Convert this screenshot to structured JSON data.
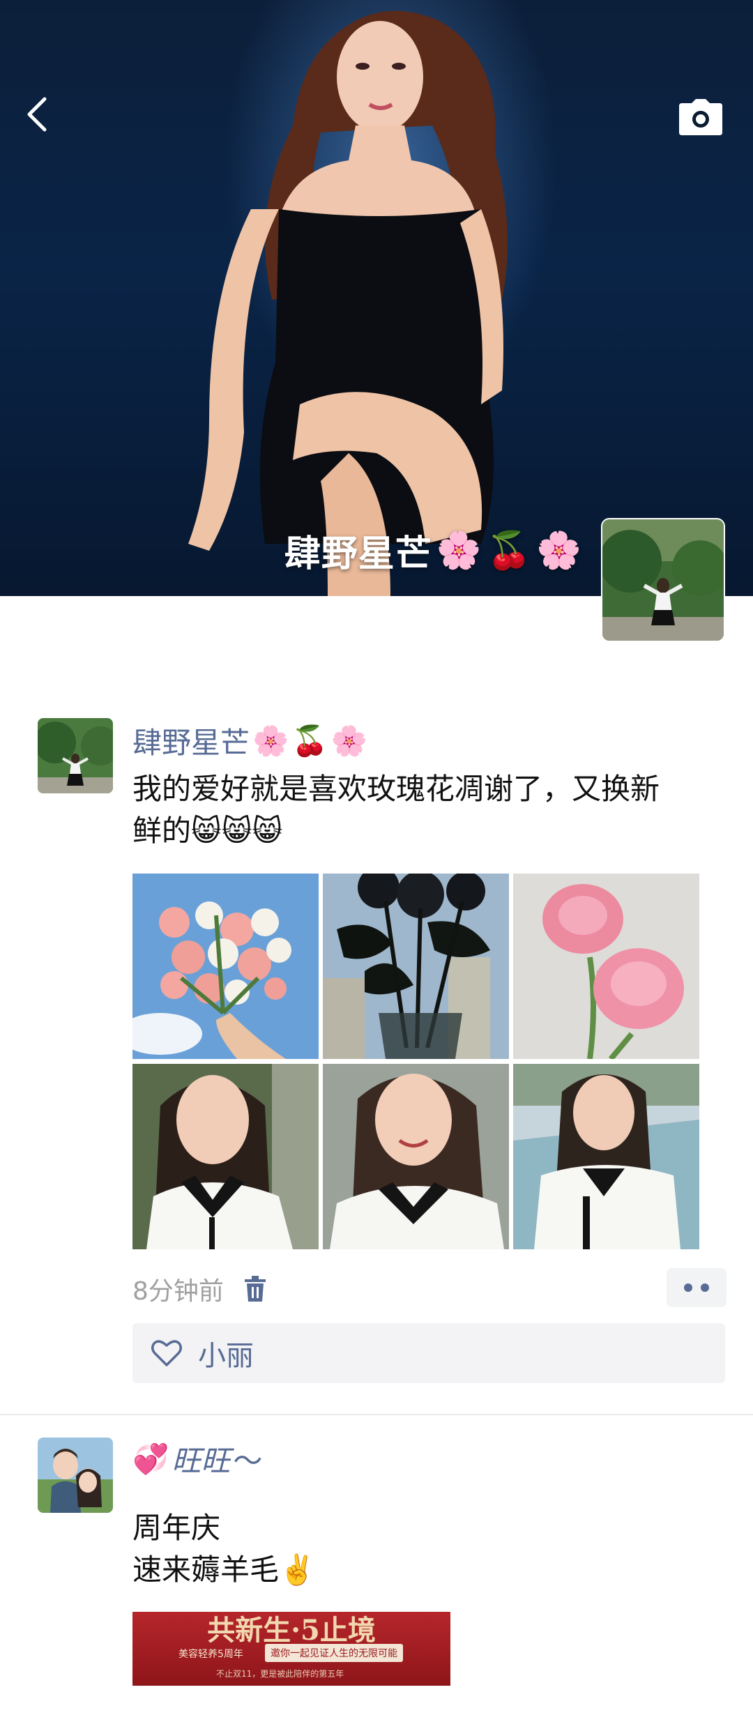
{
  "cover": {
    "name": "肆野星芒",
    "name_emojis": [
      "🌸",
      "🍒",
      "🌸"
    ]
  },
  "post1": {
    "nickname": "肆野星芒",
    "nickname_emojis": [
      "🌸",
      "🍒",
      "🌸"
    ],
    "text_line1": "我的爱好就是喜欢玫瑰花凋谢了，又换新",
    "text_line2": "鲜的",
    "text_emojis": [
      "😸",
      "😸",
      "😸"
    ],
    "time": "8分钟前",
    "likes": [
      "小丽"
    ]
  },
  "post2": {
    "nickname": "旺旺",
    "text_line1": "周年庆",
    "text_line2": "速来薅羊毛",
    "text_emoji": "✌️",
    "promo": {
      "title": "共新生·5止境",
      "sub1": "美容轻养5周年",
      "sub2": "邀你一起见证人生的无限可能",
      "sub3": "不止双11，更是被此陪伴的第五年"
    }
  },
  "colors": {
    "nickname": "#576b95",
    "meta_text": "#a0a0a0",
    "like_bg": "#f3f3f5",
    "nickname2_pink": "#e0308a"
  },
  "icons": [
    "back-icon",
    "camera-icon",
    "trash-icon",
    "more-icon",
    "heart-icon"
  ]
}
